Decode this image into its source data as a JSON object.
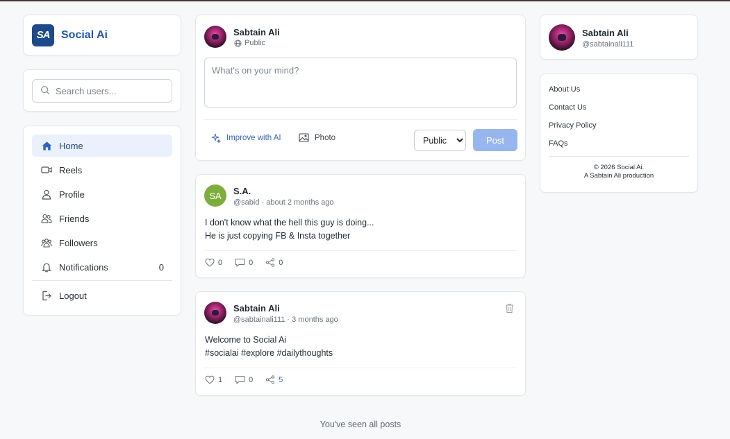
{
  "brand": {
    "logo_text": "SA",
    "name": "Social Ai"
  },
  "search": {
    "placeholder": "Search users..."
  },
  "nav": {
    "home": "Home",
    "reels": "Reels",
    "profile": "Profile",
    "friends": "Friends",
    "followers": "Followers",
    "notifications": "Notifications",
    "notifications_count": "0",
    "logout": "Logout"
  },
  "composer": {
    "author": "Sabtain Ali",
    "visibility_label": "Public",
    "placeholder": "What's on your mind?",
    "improve_label": "Improve with AI",
    "photo_label": "Photo",
    "select_options": [
      "Public"
    ],
    "post_label": "Post"
  },
  "posts": [
    {
      "avatar_initials": "SA",
      "author": "S.A.",
      "meta": "@sabid · about 2 months ago",
      "lines": [
        "I don't know what the hell this guy is doing...",
        "He is just copying FB & Insta together"
      ],
      "likes": "0",
      "comments": "0",
      "shares": "0"
    },
    {
      "author": "Sabtain Ali",
      "meta": "@sabtainali111 · 3 months ago",
      "lines": [
        "Welcome to Social Ai",
        "#socialai #explore #dailythoughts"
      ],
      "likes": "1",
      "comments": "0",
      "shares": "5"
    }
  ],
  "feed_end": "You've seen all posts",
  "profile": {
    "name": "Sabtain Ali",
    "handle": "@sabtainali111"
  },
  "links": {
    "about": "About Us",
    "contact": "Contact Us",
    "privacy": "Privacy Policy",
    "faqs": "FAQs"
  },
  "footer": {
    "copyright": "© 2026 Social Ai.",
    "credit": "A Sabtain Ali production"
  },
  "colors": {
    "accent": "#1f56b8",
    "post_button": "#97b6ee",
    "active_nav_bg": "#eaf1fd",
    "initials_avatar": "#7dae3b"
  }
}
